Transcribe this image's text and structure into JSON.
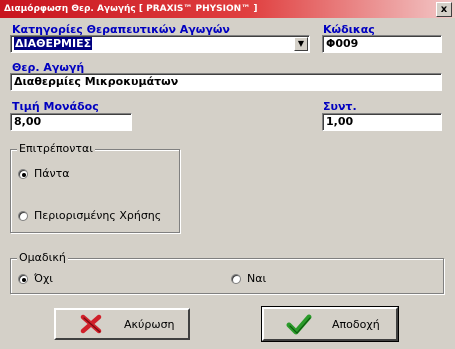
{
  "window": {
    "title": "Διαμόρφωση Θερ. Αγωγής [ PRAXIS™ PHYSION™ ]",
    "close_label": "x"
  },
  "categories": {
    "label": "Κατηγορίες Θεραπευτικών Αγωγών",
    "value": "ΔΙΑΘΕΡΜΙΕΣ"
  },
  "code": {
    "label": "Κώδικας",
    "value": "Φ009"
  },
  "treatment": {
    "label": "Θερ. Αγωγή",
    "value": "Διαθερμίες Μικροκυμάτων"
  },
  "unit_price": {
    "label": "Τιμή Μονάδος",
    "value": "8,00"
  },
  "coefficient": {
    "label": "Συντ.",
    "value": "1,00"
  },
  "allowed": {
    "legend": "Επιτρέπονται",
    "options": [
      "Πάντα",
      "Περιορισμένης Χρήσης"
    ],
    "selected": 0
  },
  "group": {
    "legend": "Ομαδική",
    "options": [
      "Όχι",
      "Ναι"
    ],
    "selected": 0
  },
  "buttons": {
    "cancel": "Ακύρωση",
    "accept": "Αποδοχή"
  },
  "colors": {
    "label_blue": "#0000c0",
    "title_red": "#c8141e",
    "cancel_icon": "#d0202a",
    "accept_icon": "#2a9a2a"
  },
  "icons": {
    "cancel": "red-x-icon",
    "accept": "green-checkmark-icon",
    "dropdown": "chevron-down-icon"
  }
}
